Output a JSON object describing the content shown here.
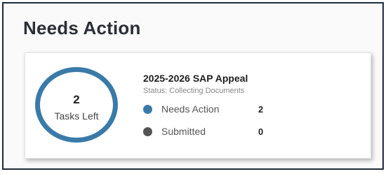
{
  "page": {
    "title": "Needs Action"
  },
  "card": {
    "tasks_left_count": "2",
    "tasks_left_label": "Tasks Left",
    "title": "2025-2026 SAP Appeal",
    "status": "Status: Collecting Documents",
    "ring_color": "#3a7aa8",
    "legend": [
      {
        "label": "Needs Action",
        "count": "2",
        "color": "#3a7aa8"
      },
      {
        "label": "Submitted",
        "count": "0",
        "color": "#555555"
      }
    ]
  }
}
